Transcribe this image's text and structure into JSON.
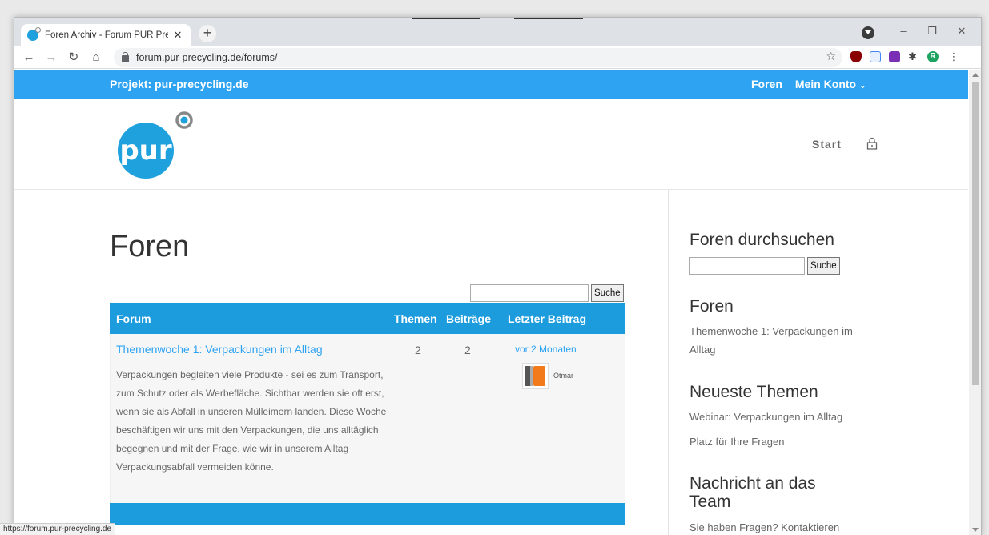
{
  "browser": {
    "tab_title": "Foren Archiv - Forum PUR Precyc",
    "tab_close": "✕",
    "new_tab": "+",
    "url": "forum.pur-precycling.de/forums/",
    "status_url": "https://forum.pur-precycling.de",
    "icons": [
      "back-icon",
      "forward-icon",
      "reload-icon",
      "home-icon",
      "lock-icon",
      "star-icon",
      "ublock-icon",
      "docs-icon",
      "onenote-icon",
      "extensions-icon",
      "profile-icon",
      "menu-icon"
    ],
    "profile_initial": "R",
    "window_controls": [
      "–",
      "❐",
      "✕"
    ]
  },
  "topbar": {
    "project": "Projekt: pur-precycling.de",
    "nav": [
      "Foren",
      "Mein Konto"
    ],
    "caret": "⌄"
  },
  "header": {
    "logo_text": "pur",
    "start_label": "Start"
  },
  "main": {
    "title": "Foren",
    "search_button": "Suche",
    "table": {
      "columns": [
        "Forum",
        "Themen",
        "Beiträge",
        "Letzter Beitrag"
      ],
      "rows": [
        {
          "forum": "Themenwoche 1: Verpackungen im Alltag",
          "description": "Verpackungen begleiten viele Produkte - sei es zum Transport, zum Schutz oder als Werbefläche. Sichtbar werden sie oft erst, wenn sie als Abfall in unseren Mülleimern landen. Diese Woche beschäftigen wir uns mit den Verpackungen, die uns alltäglich begegnen und mit der Frage, wie wir in unserem Alltag Verpackungsabfall vermeiden könne.",
          "topics": "2",
          "posts": "2",
          "last_post": "vor 2 Monaten",
          "author": "Otmar"
        }
      ]
    }
  },
  "sidebar": {
    "search_heading": "Foren durchsuchen",
    "search_button": "Suche",
    "forums_heading": "Foren",
    "forums_link": "Themenwoche 1: Verpackungen im Alltag",
    "latest_heading": "Neueste Themen",
    "latest_topics": [
      "Webinar: Verpackungen im Alltag",
      "Platz für Ihre Fragen"
    ],
    "message_heading": "Nachricht an das Team",
    "message_text": "Sie haben Fragen? Kontaktieren"
  },
  "colors": {
    "brand_blue": "#2ea3f2",
    "table_blue": "#1c9cdd",
    "logo_blue": "#1fa1de"
  }
}
